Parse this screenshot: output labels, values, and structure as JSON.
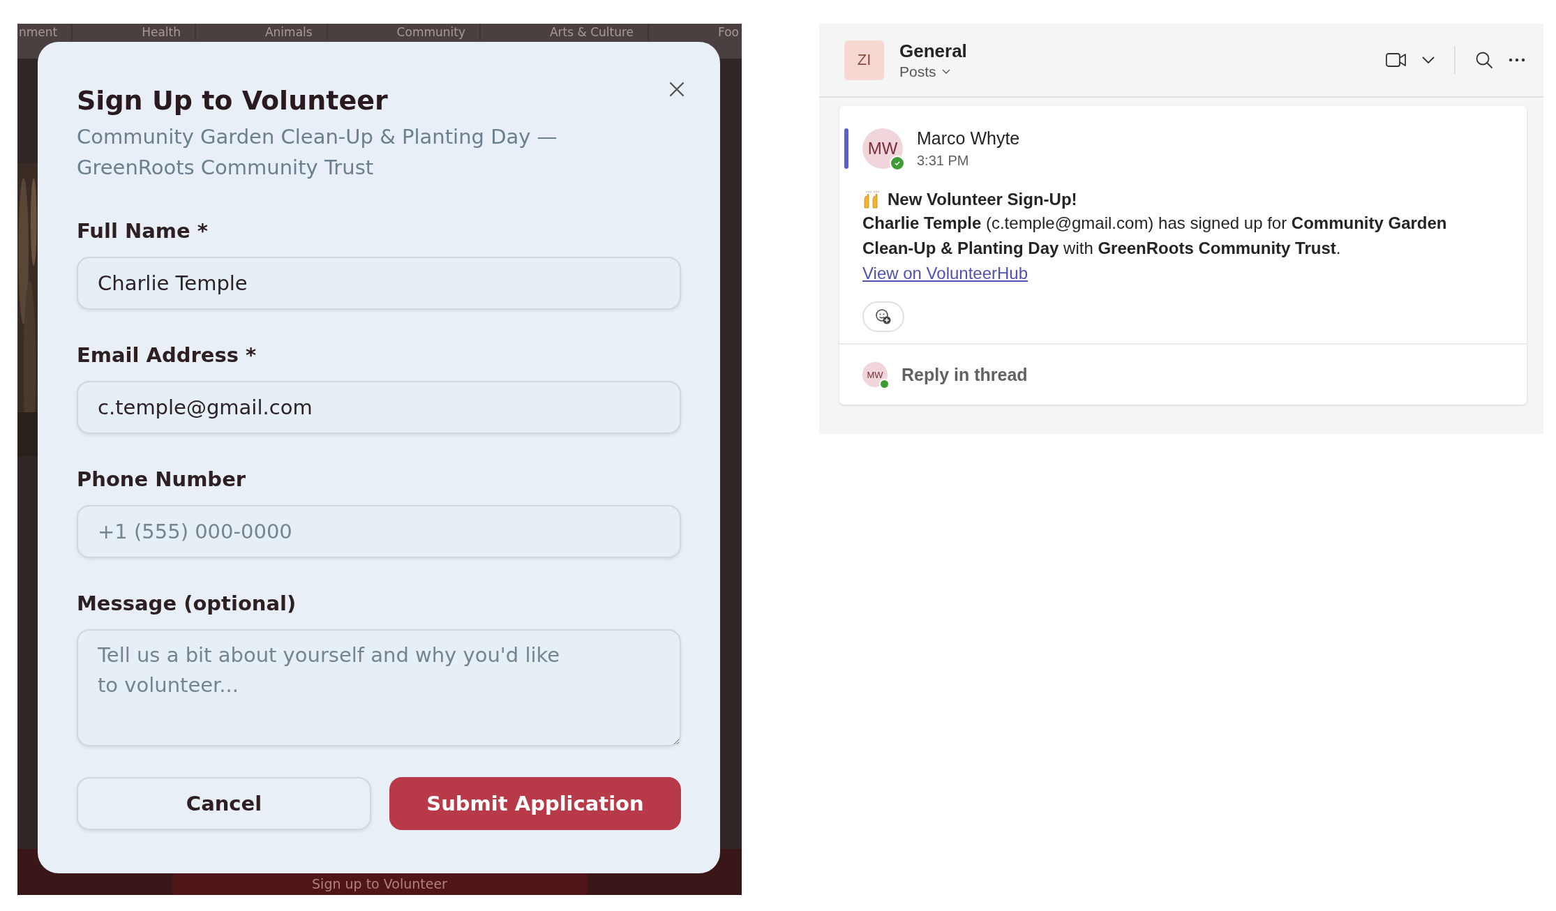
{
  "background_page": {
    "nav_tabs": [
      "nment",
      "Health",
      "Animals",
      "Community",
      "Arts & Culture",
      "Foo"
    ],
    "bottom_button": "Sign up to Volunteer"
  },
  "modal": {
    "title": "Sign Up to Volunteer",
    "subtitle": "Community Garden Clean-Up & Planting Day — GreenRoots Community Trust",
    "fields": [
      {
        "kind": "input",
        "label": "Full Name *",
        "value": "Charlie Temple"
      },
      {
        "kind": "input",
        "label": "Email Address *",
        "value": "c.temple@gmail.com"
      },
      {
        "kind": "input",
        "label": "Phone Number",
        "placeholder": "+1 (555) 000-0000"
      },
      {
        "kind": "textarea",
        "label": "Message (optional)",
        "placeholder": "Tell us a bit about yourself and why you'd like to volunteer..."
      }
    ],
    "buttons": [
      {
        "kind": "secondary",
        "label": "Cancel"
      },
      {
        "kind": "primary",
        "label": "Submit Application"
      }
    ]
  },
  "chat": {
    "channel": {
      "avatar": "ZI",
      "name": "General",
      "view": "Posts"
    },
    "post": {
      "initials": "MW",
      "online": true,
      "author": "Marco Whyte",
      "time": "3:31 PM",
      "headline": "New Volunteer Sign-Up!",
      "body": "**Charlie Temple** (c.temple@gmail.com) has signed up for **Community Garden Clean-Up & Planting Day** with **GreenRoots Community Trust**.",
      "link": "View on VolunteerHub"
    },
    "reply": {
      "initials": "MW",
      "online": true,
      "label": "Reply in thread"
    }
  }
}
